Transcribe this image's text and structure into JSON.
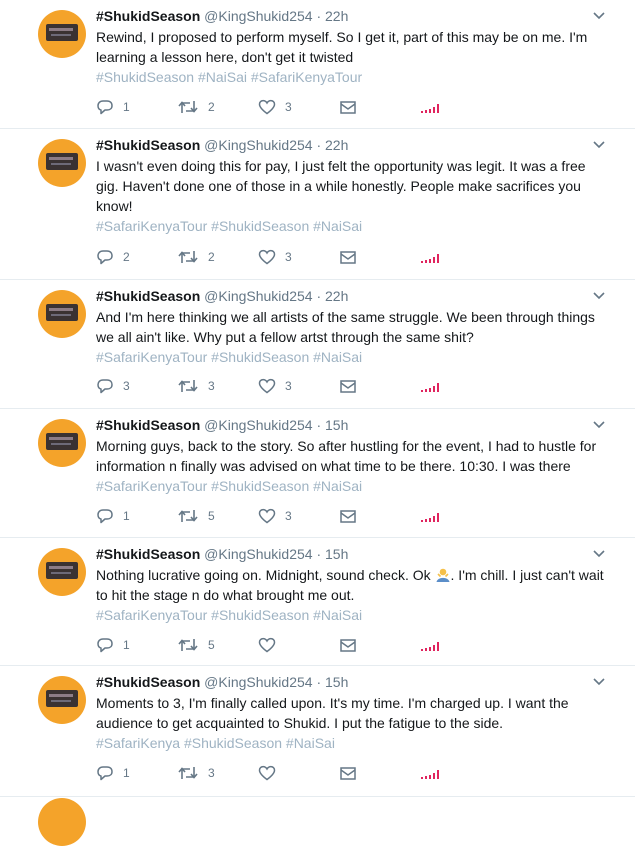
{
  "tweets": [
    {
      "name": "#ShukidSeason",
      "handle": "@KingShukid254",
      "time": "22h",
      "text": "Rewind, I proposed to perform myself. So I get it, part of this may be on me. I'm learning a lesson here, don't get it twisted",
      "tags": "#ShukidSeason #NaiSai #SafariKenyaTour",
      "replies": "1",
      "retweets": "2",
      "likes": "3"
    },
    {
      "name": "#ShukidSeason",
      "handle": "@KingShukid254",
      "time": "22h",
      "text": "I wasn't even doing this for pay, I just felt the opportunity was legit. It was a free gig. Haven't done one of those in a while honestly. People make sacrifices you know!",
      "tags": "#SafariKenyaTour #ShukidSeason #NaiSai",
      "replies": "2",
      "retweets": "2",
      "likes": "3"
    },
    {
      "name": "#ShukidSeason",
      "handle": "@KingShukid254",
      "time": "22h",
      "text": "And I'm here thinking we all artists of the same struggle. We been through things we all ain't like. Why put a fellow artst through the same shit?",
      "tags": "#SafariKenyaTour #ShukidSeason #NaiSai",
      "replies": "3",
      "retweets": "3",
      "likes": "3"
    },
    {
      "name": "#ShukidSeason",
      "handle": "@KingShukid254",
      "time": "15h",
      "text": "Morning guys, back to the story. So after hustling for the event, I had to hustle for information n finally was advised on what time to be there. 10:30. I was there",
      "tags": "#SafariKenyaTour #ShukidSeason #NaiSai",
      "replies": "1",
      "retweets": "5",
      "likes": "3"
    },
    {
      "name": "#ShukidSeason",
      "handle": "@KingShukid254",
      "time": "15h",
      "text_before": "Nothing lucrative going on. Midnight, sound check. Ok ",
      "text_after": ". I'm chill. I just can't wait to hit the stage n do what brought me out.",
      "tags": "#SafariKenyaTour #ShukidSeason #NaiSai",
      "replies": "1",
      "retweets": "5",
      "likes": ""
    },
    {
      "name": "#ShukidSeason",
      "handle": "@KingShukid254",
      "time": "15h",
      "text": "Moments to 3, I'm finally called upon. It's my time. I'm charged up. I want the audience to get acquainted to Shukid. I put the fatigue to the side.",
      "tags": "#SafariKenya #ShukidSeason #NaiSai",
      "replies": "1",
      "retweets": "3",
      "likes": ""
    }
  ],
  "ui": {
    "separator": "·",
    "accent": "#1da1f2",
    "analytics_color": "#e0245e"
  }
}
